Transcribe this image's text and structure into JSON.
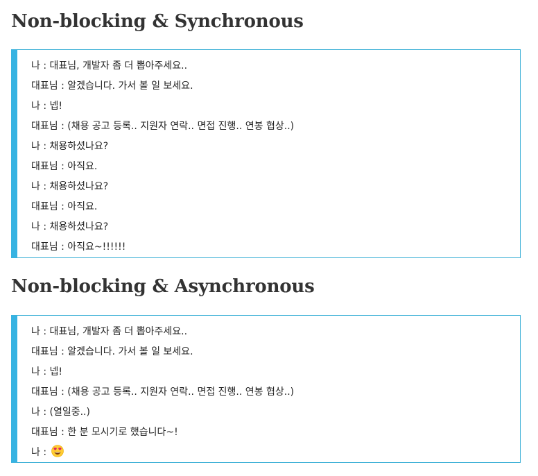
{
  "sections": [
    {
      "heading": "Non-blocking & Synchronous",
      "lines": [
        "나 : 대표님, 개발자 좀 더 뽑아주세요..",
        "대표님 : 알겠습니다. 가서 볼 일 보세요.",
        "나 : 넵!",
        "대표님 : (채용 공고 등록.. 지원자 연락.. 면접 진행.. 연봉 협상..)",
        "나 : 채용하셨나요?",
        "대표님 : 아직요.",
        "나 : 채용하셨나요?",
        "대표님 : 아직요.",
        "나 : 채용하셨나요?",
        "대표님 : 아직요~!!!!!!"
      ]
    },
    {
      "heading": "Non-blocking & Asynchronous",
      "lines": [
        "나 : 대표님, 개발자 좀 더 뽑아주세요..",
        "대표님 : 알겠습니다. 가서 볼 일 보세요.",
        "나 : 넵!",
        "대표님 : (채용 공고 등록.. 지원자 연락.. 면접 진행.. 연봉 협상..)",
        "나 : (열일중..)",
        "대표님 : 한 분 모시기로 했습니다~!",
        "나 : "
      ],
      "last_line_icon": "heart-eyes-emoji-icon"
    }
  ],
  "colors": {
    "accent_bar": "#37b3e2",
    "border": "#3bb0d6",
    "heading_text": "#333333",
    "body_text": "#222222"
  }
}
